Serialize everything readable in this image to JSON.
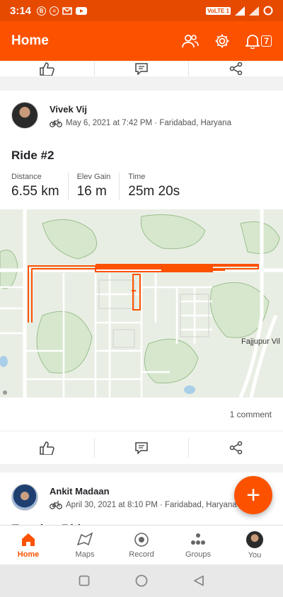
{
  "status_bar": {
    "time": "3:14",
    "volte": "VoLTE 1"
  },
  "app_bar": {
    "title": "Home",
    "notification_count": "7"
  },
  "activities": [
    {
      "athlete": "Vivek Vij",
      "date_location": "May 6, 2021 at 7:42 PM · Faridabad, Haryana",
      "title": "Ride #2",
      "stats": [
        {
          "label": "Distance",
          "value": "6.55 km"
        },
        {
          "label": "Elev Gain",
          "value": "16 m"
        },
        {
          "label": "Time",
          "value": "25m 20s"
        }
      ],
      "map_label": "Fajjupur Vil",
      "comment_count": "1 comment"
    },
    {
      "athlete": "Ankit Madaan",
      "date_location": "April 30, 2021 at 8:10 PM · Faridabad, Haryana",
      "title": "Evening Ride"
    }
  ],
  "fab": {
    "symbol": "+"
  },
  "bottom_nav": [
    {
      "label": "Home",
      "icon": "home-icon",
      "active": true
    },
    {
      "label": "Maps",
      "icon": "maps-icon"
    },
    {
      "label": "Record",
      "icon": "record-icon"
    },
    {
      "label": "Groups",
      "icon": "groups-icon"
    },
    {
      "label": "You",
      "icon": "profile-avatar"
    }
  ],
  "colors": {
    "brand": "#fc5200",
    "status_bar": "#e64a00",
    "route": "#fc5200"
  }
}
